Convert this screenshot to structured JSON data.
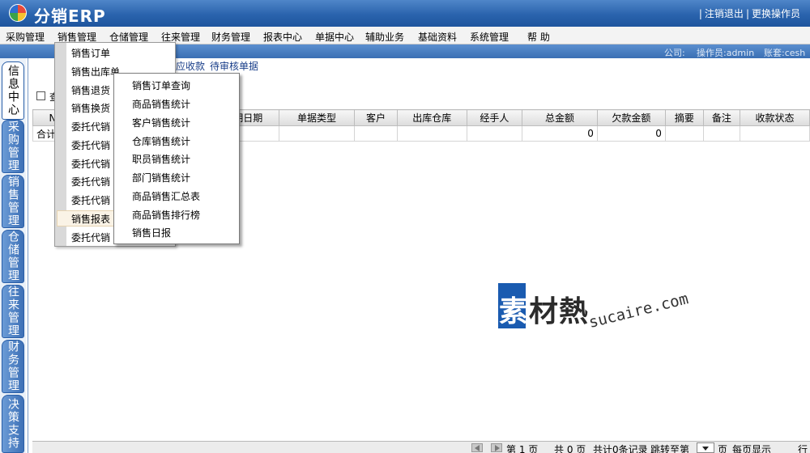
{
  "app": {
    "title": "分销ERP"
  },
  "header": {
    "logout": "注销退出",
    "switch_user": "更换操作员"
  },
  "menubar": [
    "采购管理",
    "销售管理",
    "仓储管理",
    "往来管理",
    "财务管理",
    "报表中心",
    "单据中心",
    "辅助业务",
    "基础资料",
    "系统管理",
    "帮 助"
  ],
  "infobar": {
    "company": "公司:",
    "operator": "操作员:admin",
    "account": "账套:cesh"
  },
  "vtabs": [
    "信息中心",
    "采购管理",
    "销售管理",
    "仓储管理",
    "往来管理",
    "财务管理",
    "决策支持"
  ],
  "links": [
    "期应收款",
    "待审核单据"
  ],
  "checkbox_label": "查",
  "sales_menu": [
    "销售订单",
    "销售出库单",
    "销售退货",
    "销售换货",
    "委托代销",
    "委托代销",
    "委托代销",
    "委托代销",
    "委托代销",
    "销售报表",
    "委托代销"
  ],
  "report_menu": [
    "销售订单查询",
    "商品销售统计",
    "客户销售统计",
    "仓库销售统计",
    "职员销售统计",
    "部门销售统计",
    "商品销售汇总表",
    "商品销售排行榜",
    "销售日报"
  ],
  "table": {
    "headers": [
      "NO",
      "",
      "期日期",
      "单据类型",
      "客户",
      "出库仓库",
      "经手人",
      "总金额",
      "欠款金额",
      "摘要",
      "备注",
      "收款状态"
    ],
    "total_row": {
      "label": "合计",
      "total_amount": "0",
      "owed_amount": "0"
    }
  },
  "pager": {
    "page_label": "第 1 页",
    "total_pages": "共 0 页",
    "record_count": "共计0条记录",
    "jump_to": "跳转至第",
    "page_suffix": "页",
    "per_page": "每页显示",
    "row_suffix": "行"
  },
  "watermark": {
    "cn_first": "素",
    "cn_rest": "材熱",
    "en": "sucaire.com"
  }
}
